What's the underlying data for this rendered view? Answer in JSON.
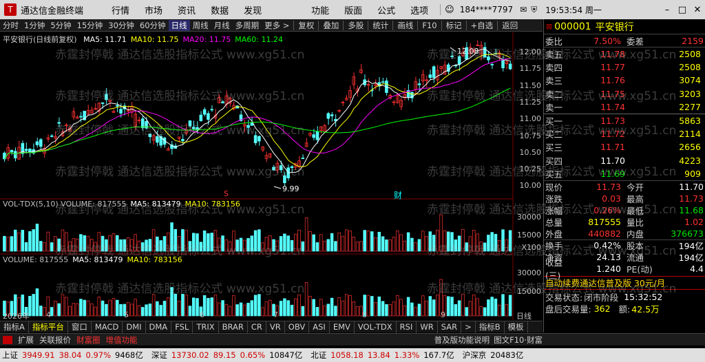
{
  "titlebar": {
    "app_title": "通达信金融终端",
    "menus": [
      "行情",
      "市场",
      "资讯",
      "数据",
      "发现",
      "功能",
      "版面",
      "公式",
      "选项"
    ],
    "user": "184****7797",
    "time": "19:53:54 周一"
  },
  "toolbar": {
    "periods": [
      "分时",
      "1分钟",
      "5分钟",
      "15分钟",
      "30分钟",
      "60分钟",
      "日线",
      "周线",
      "月线",
      "多周期",
      "更多 >"
    ],
    "active_period": "日线",
    "tools": [
      "复权",
      "叠加",
      "多股",
      "统计",
      "画线",
      "F10",
      "标记",
      "+自选",
      "返回"
    ]
  },
  "chart": {
    "legend_title": "平安银行(日线前复权)",
    "legend_items": [
      {
        "text": "MA5: 11.71",
        "color": "#ffffff"
      },
      {
        "text": "MA10: 11.75",
        "color": "#ffff00"
      },
      {
        "text": "MA20: 11.75",
        "color": "#ff00ff"
      },
      {
        "text": "MA60: 11.24",
        "color": "#00ff00"
      }
    ],
    "high_label": "12.08",
    "low_label": "9.99",
    "marker_s": "S",
    "marker_cai": "财",
    "price_axis": [
      "12.00",
      "11.75",
      "11.50",
      "11.25",
      "11.00",
      "10.75",
      "10.50",
      "10.25",
      "10.00"
    ],
    "vol1_legend": [
      {
        "text": "VOL-TDX(5,10) VOLUME: 817555",
        "color": "#c0c0c0"
      },
      {
        "text": "MA5: 813479",
        "color": "#ffffff"
      },
      {
        "text": "MA10: 783156",
        "color": "#ffff00"
      }
    ],
    "vol1_axis": [
      "30000",
      "15000",
      "X100"
    ],
    "vol2_legend": [
      {
        "text": "VOLUME: 817555",
        "color": "#c0c0c0"
      },
      {
        "text": "MA5: 813479",
        "color": "#ffffff"
      },
      {
        "text": "MA10: 783156",
        "color": "#ffff00"
      }
    ],
    "vol2_axis": [
      "30000",
      "15000"
    ],
    "dates": [
      "2026年",
      "4",
      "5",
      "6",
      "7",
      "8",
      "9"
    ],
    "date_axis_label": "日线",
    "watermark": "赤霆封停戟 通达信选股指标公式 www.xg51.cn"
  },
  "chart_data": {
    "type": "line",
    "title": "平安银行(日线前复权)",
    "series": [
      {
        "name": "MA5",
        "last": 11.71
      },
      {
        "name": "MA10",
        "last": 11.75
      },
      {
        "name": "MA20",
        "last": 11.75
      },
      {
        "name": "MA60",
        "last": 11.24
      }
    ],
    "ylim": [
      9.99,
      12.08
    ],
    "volume": 817555,
    "vol_ma5": 813479,
    "vol_ma10": 783156
  },
  "quote": {
    "code": "000001",
    "name": "平安银行",
    "weibi_label": "委比",
    "weibi": "7.50%",
    "weicha_label": "委差",
    "weicha": "2159",
    "asks": [
      {
        "label": "卖五",
        "price": "11.78",
        "vol": "2508"
      },
      {
        "label": "卖四",
        "price": "11.77",
        "vol": "2508"
      },
      {
        "label": "卖三",
        "price": "11.76",
        "vol": "3074"
      },
      {
        "label": "卖二",
        "price": "11.75",
        "vol": "3203"
      },
      {
        "label": "卖一",
        "price": "11.74",
        "vol": "2277"
      }
    ],
    "bids": [
      {
        "label": "买一",
        "price": "11.73",
        "vol": "5863"
      },
      {
        "label": "买二",
        "price": "11.72",
        "vol": "2114"
      },
      {
        "label": "买三",
        "price": "11.71",
        "vol": "2656"
      },
      {
        "label": "买四",
        "price": "11.70",
        "vol": "4223"
      },
      {
        "label": "买五",
        "price": "11.69",
        "vol": "909"
      }
    ],
    "stats": [
      {
        "k": "现价",
        "v": "11.73",
        "vc": "red",
        "k2": "今开",
        "v2": "11.70",
        "v2c": "white"
      },
      {
        "k": "涨跌",
        "v": "0.03",
        "vc": "red",
        "k2": "最高",
        "v2": "11.73",
        "v2c": "red"
      },
      {
        "k": "涨幅",
        "v": "0.26%",
        "vc": "red",
        "k2": "最低",
        "v2": "11.68",
        "v2c": "green"
      },
      {
        "k": "总量",
        "v": "817555",
        "vc": "yellow",
        "k2": "量比",
        "v2": "1.02",
        "v2c": "red"
      },
      {
        "k": "外盘",
        "v": "440882",
        "vc": "red",
        "k2": "内盘",
        "v2": "376673",
        "v2c": "green"
      },
      {
        "k": "换手",
        "v": "0.42%",
        "vc": "white",
        "k2": "股本",
        "v2": "194亿",
        "v2c": "white"
      },
      {
        "k": "净资",
        "v": "24.13",
        "vc": "white",
        "k2": "流通",
        "v2": "194亿",
        "v2c": "white"
      },
      {
        "k": "收益(三)",
        "v": "1.240",
        "vc": "white",
        "k2": "PE(动)",
        "v2": "4.4",
        "v2c": "white"
      }
    ],
    "promo": "自动续费通达信普及版 30元/月",
    "trade_state_label": "交易状态:",
    "trade_state": "闭市阶段",
    "trade_time": "15:32:52",
    "after_vol_label": "盘后交易量:",
    "after_vol": "362",
    "after_amt_label": "额:",
    "after_amt": "42.5万"
  },
  "index_tabs": [
    "指标A",
    "指标平台",
    "窗口",
    "MACD",
    "DMI",
    "DMA",
    "FSL",
    "TRIX",
    "BRAR",
    "CR",
    "VR",
    "OBV",
    "ASI",
    "EMV",
    "VOL-TDX",
    "RSI",
    "WR",
    "SAR",
    ">",
    "指标B",
    "模板"
  ],
  "ext_bar": {
    "left": [
      "扩展",
      "关联报价",
      "财富圈",
      "增值功能"
    ],
    "right": "普及版功能说明",
    "right2": "图文F10·财富"
  },
  "status": [
    {
      "t": "上证",
      "c": "#000"
    },
    {
      "t": "3949.91",
      "c": "#d00000"
    },
    {
      "t": "38.04",
      "c": "#d00000"
    },
    {
      "t": "0.97%",
      "c": "#d00000"
    },
    {
      "t": "9468亿",
      "c": "#000"
    },
    {
      "t": "深证",
      "c": "#000"
    },
    {
      "t": "13730.02",
      "c": "#d00000"
    },
    {
      "t": "89.15",
      "c": "#d00000"
    },
    {
      "t": "0.65%",
      "c": "#d00000"
    },
    {
      "t": "10847亿",
      "c": "#000"
    },
    {
      "t": "北证",
      "c": "#000"
    },
    {
      "t": "1058.18",
      "c": "#d00000"
    },
    {
      "t": "13.84",
      "c": "#d00000"
    },
    {
      "t": "1.33%",
      "c": "#d00000"
    },
    {
      "t": "167.7亿",
      "c": "#000"
    },
    {
      "t": "沪深京",
      "c": "#000"
    },
    {
      "t": "20483亿",
      "c": "#000"
    }
  ]
}
